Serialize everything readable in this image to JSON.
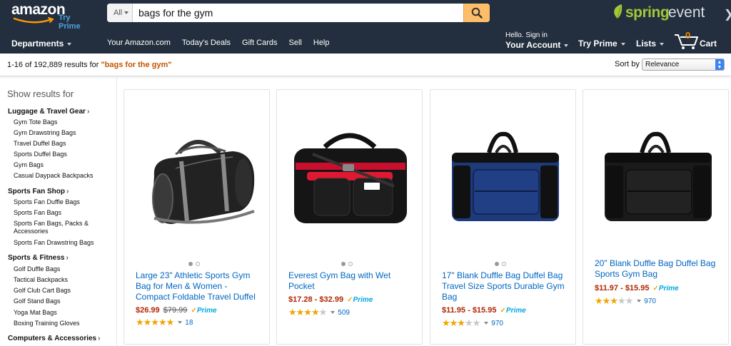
{
  "header": {
    "logo_text": "amazon",
    "try_prime_tag": "Try Prime",
    "search": {
      "category": "All",
      "query": "bags for the gym"
    },
    "promo": {
      "part1": "spring",
      "part2": "event"
    },
    "departments_label": "Departments",
    "nav_links": [
      "Your Amazon.com",
      "Today's Deals",
      "Gift Cards",
      "Sell",
      "Help"
    ],
    "account": {
      "greeting": "Hello. Sign in",
      "label": "Your Account"
    },
    "try_prime_label": "Try Prime",
    "lists_label": "Lists",
    "cart": {
      "count": "0",
      "label": "Cart"
    }
  },
  "results": {
    "summary": "1-16 of 192,889 results for ",
    "query_quoted": "\"bags for the gym\"",
    "sort_label": "Sort by",
    "sort_value": "Relevance"
  },
  "sidebar": {
    "title": "Show results for",
    "groups": [
      {
        "name": "Luggage & Travel Gear",
        "items": [
          "Gym Tote Bags",
          "Gym Drawstring Bags",
          "Travel Duffel Bags",
          "Sports Duffel Bags",
          "Gym Bags",
          "Casual Daypack Backpacks"
        ]
      },
      {
        "name": "Sports Fan Shop",
        "items": [
          "Sports Fan Duffle Bags",
          "Sports Fan Bags",
          "Sports Fan Bags, Packs & Accessories",
          "Sports Fan Drawstring Bags"
        ]
      },
      {
        "name": "Sports & Fitness",
        "items": [
          "Golf Duffle Bags",
          "Tactical Backpacks",
          "Golf Club Cart Bags",
          "Golf Stand Bags",
          "Yoga Mat Bags",
          "Boxing Training Gloves"
        ]
      },
      {
        "name": "Computers & Accessories",
        "items": []
      }
    ]
  },
  "products": [
    {
      "title": "Large 23\" Athletic Sports Gym Bag for Men & Women - Compact Foldable Travel Duffel",
      "price": "$26.99",
      "list_price": "$79.99",
      "prime": "Prime",
      "rating": 5,
      "reviews": "18"
    },
    {
      "title": "Everest Gym Bag with Wet Pocket",
      "price": "$17.28 - $32.99",
      "list_price": "",
      "prime": "Prime",
      "rating": 4.5,
      "reviews": "509"
    },
    {
      "title": "17\" Blank Duffle Bag Duffel Bag Travel Size Sports Durable Gym Bag",
      "price": "$11.95 - $15.95",
      "list_price": "",
      "prime": "Prime",
      "rating": 3.5,
      "reviews": "970"
    },
    {
      "title": "20\" Blank Duffle Bag Duffel Bag Sports Gym Bag",
      "price": "$11.97 - $15.95",
      "list_price": "",
      "prime": "Prime",
      "rating": 3.5,
      "reviews": "970"
    }
  ],
  "colors": {
    "nav_bg": "#232f3e",
    "search_button": "#febd69",
    "link": "#0066c0",
    "price": "#b12704",
    "query_highlight": "#c45500",
    "star": "#f0a500",
    "prime": "#00a8e1"
  }
}
